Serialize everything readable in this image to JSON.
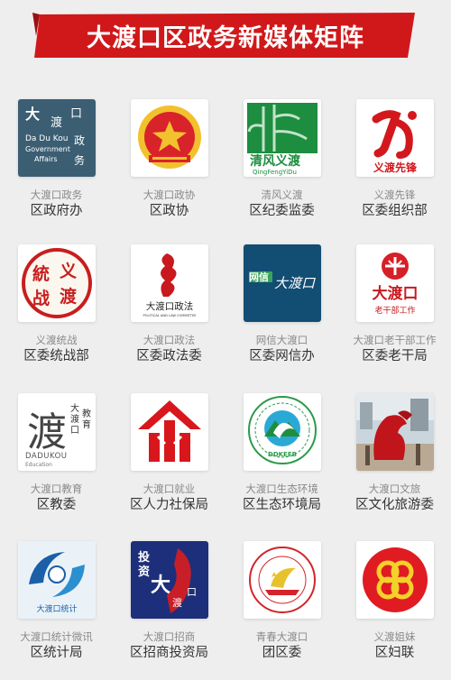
{
  "header": {
    "title": "大渡口区政务新媒体矩阵"
  },
  "colors": {
    "banner": "#d0181b",
    "banner_dark": "#9c0f12",
    "page_bg": "#eeeeee"
  },
  "accounts": [
    {
      "account": "大渡口政务",
      "department": "区政府办",
      "icon": "dadukou-government-affairs-logo",
      "logo_text": [
        "大",
        "渡",
        "口",
        "Da Du Kou",
        "Government",
        "Affairs",
        "政",
        "务"
      ]
    },
    {
      "account": "大渡口政协",
      "department": "区政协",
      "icon": "cppcc-emblem"
    },
    {
      "account": "清风义渡",
      "department": "区纪委监委",
      "icon": "qingfeng-yidu-logo",
      "logo_text": [
        "清风义渡",
        "QingFengYiDu"
      ]
    },
    {
      "account": "义渡先锋",
      "department": "区委组织部",
      "icon": "yidu-xianfeng-logo",
      "logo_text": [
        "义渡先锋"
      ]
    },
    {
      "account": "义渡统战",
      "department": "区委统战部",
      "icon": "yidu-tongzhan-seal",
      "logo_text": [
        "統",
        "义",
        "战",
        "渡"
      ]
    },
    {
      "account": "大渡口政法",
      "department": "区委政法委",
      "icon": "political-legal-committee-seal",
      "logo_text": [
        "大渡口政法",
        "POLITICAL AND LAW COMMITTEE"
      ]
    },
    {
      "account": "网信大渡口",
      "department": "区委网信办",
      "icon": "wangxin-dadukou-logo",
      "logo_text": [
        "网信",
        "大渡口"
      ]
    },
    {
      "account": "大渡口老干部工作",
      "department": "区委老干局",
      "icon": "veteran-cadres-logo",
      "logo_text": [
        "大渡口",
        "老干部工作"
      ]
    },
    {
      "account": "大渡口教育",
      "department": "区教委",
      "icon": "education-logo",
      "logo_text": [
        "渡",
        "大",
        "渡",
        "口",
        "教",
        "育",
        "DADUKOU",
        "Education"
      ]
    },
    {
      "account": "大渡口就业",
      "department": "区人力社保局",
      "icon": "employment-logo"
    },
    {
      "account": "大渡口生态环境",
      "department": "区生态环境局",
      "icon": "ecology-environment-logo",
      "logo_text": [
        "DDKEEB"
      ]
    },
    {
      "account": "大渡口文旅",
      "department": "区文化旅游委",
      "icon": "culture-tourism-photo"
    },
    {
      "account": "大渡口统计微讯",
      "department": "区统计局",
      "icon": "statistics-logo",
      "logo_text": [
        "大渡口统计"
      ]
    },
    {
      "account": "大渡口招商",
      "department": "区招商投资局",
      "icon": "investment-logo",
      "logo_text": [
        "投",
        "资",
        "大",
        "渡",
        "口"
      ]
    },
    {
      "account": "青春大渡口",
      "department": "团区委",
      "icon": "youth-league-emblem"
    },
    {
      "account": "义渡姐妹",
      "department": "区妇联",
      "icon": "womens-federation-logo"
    }
  ]
}
